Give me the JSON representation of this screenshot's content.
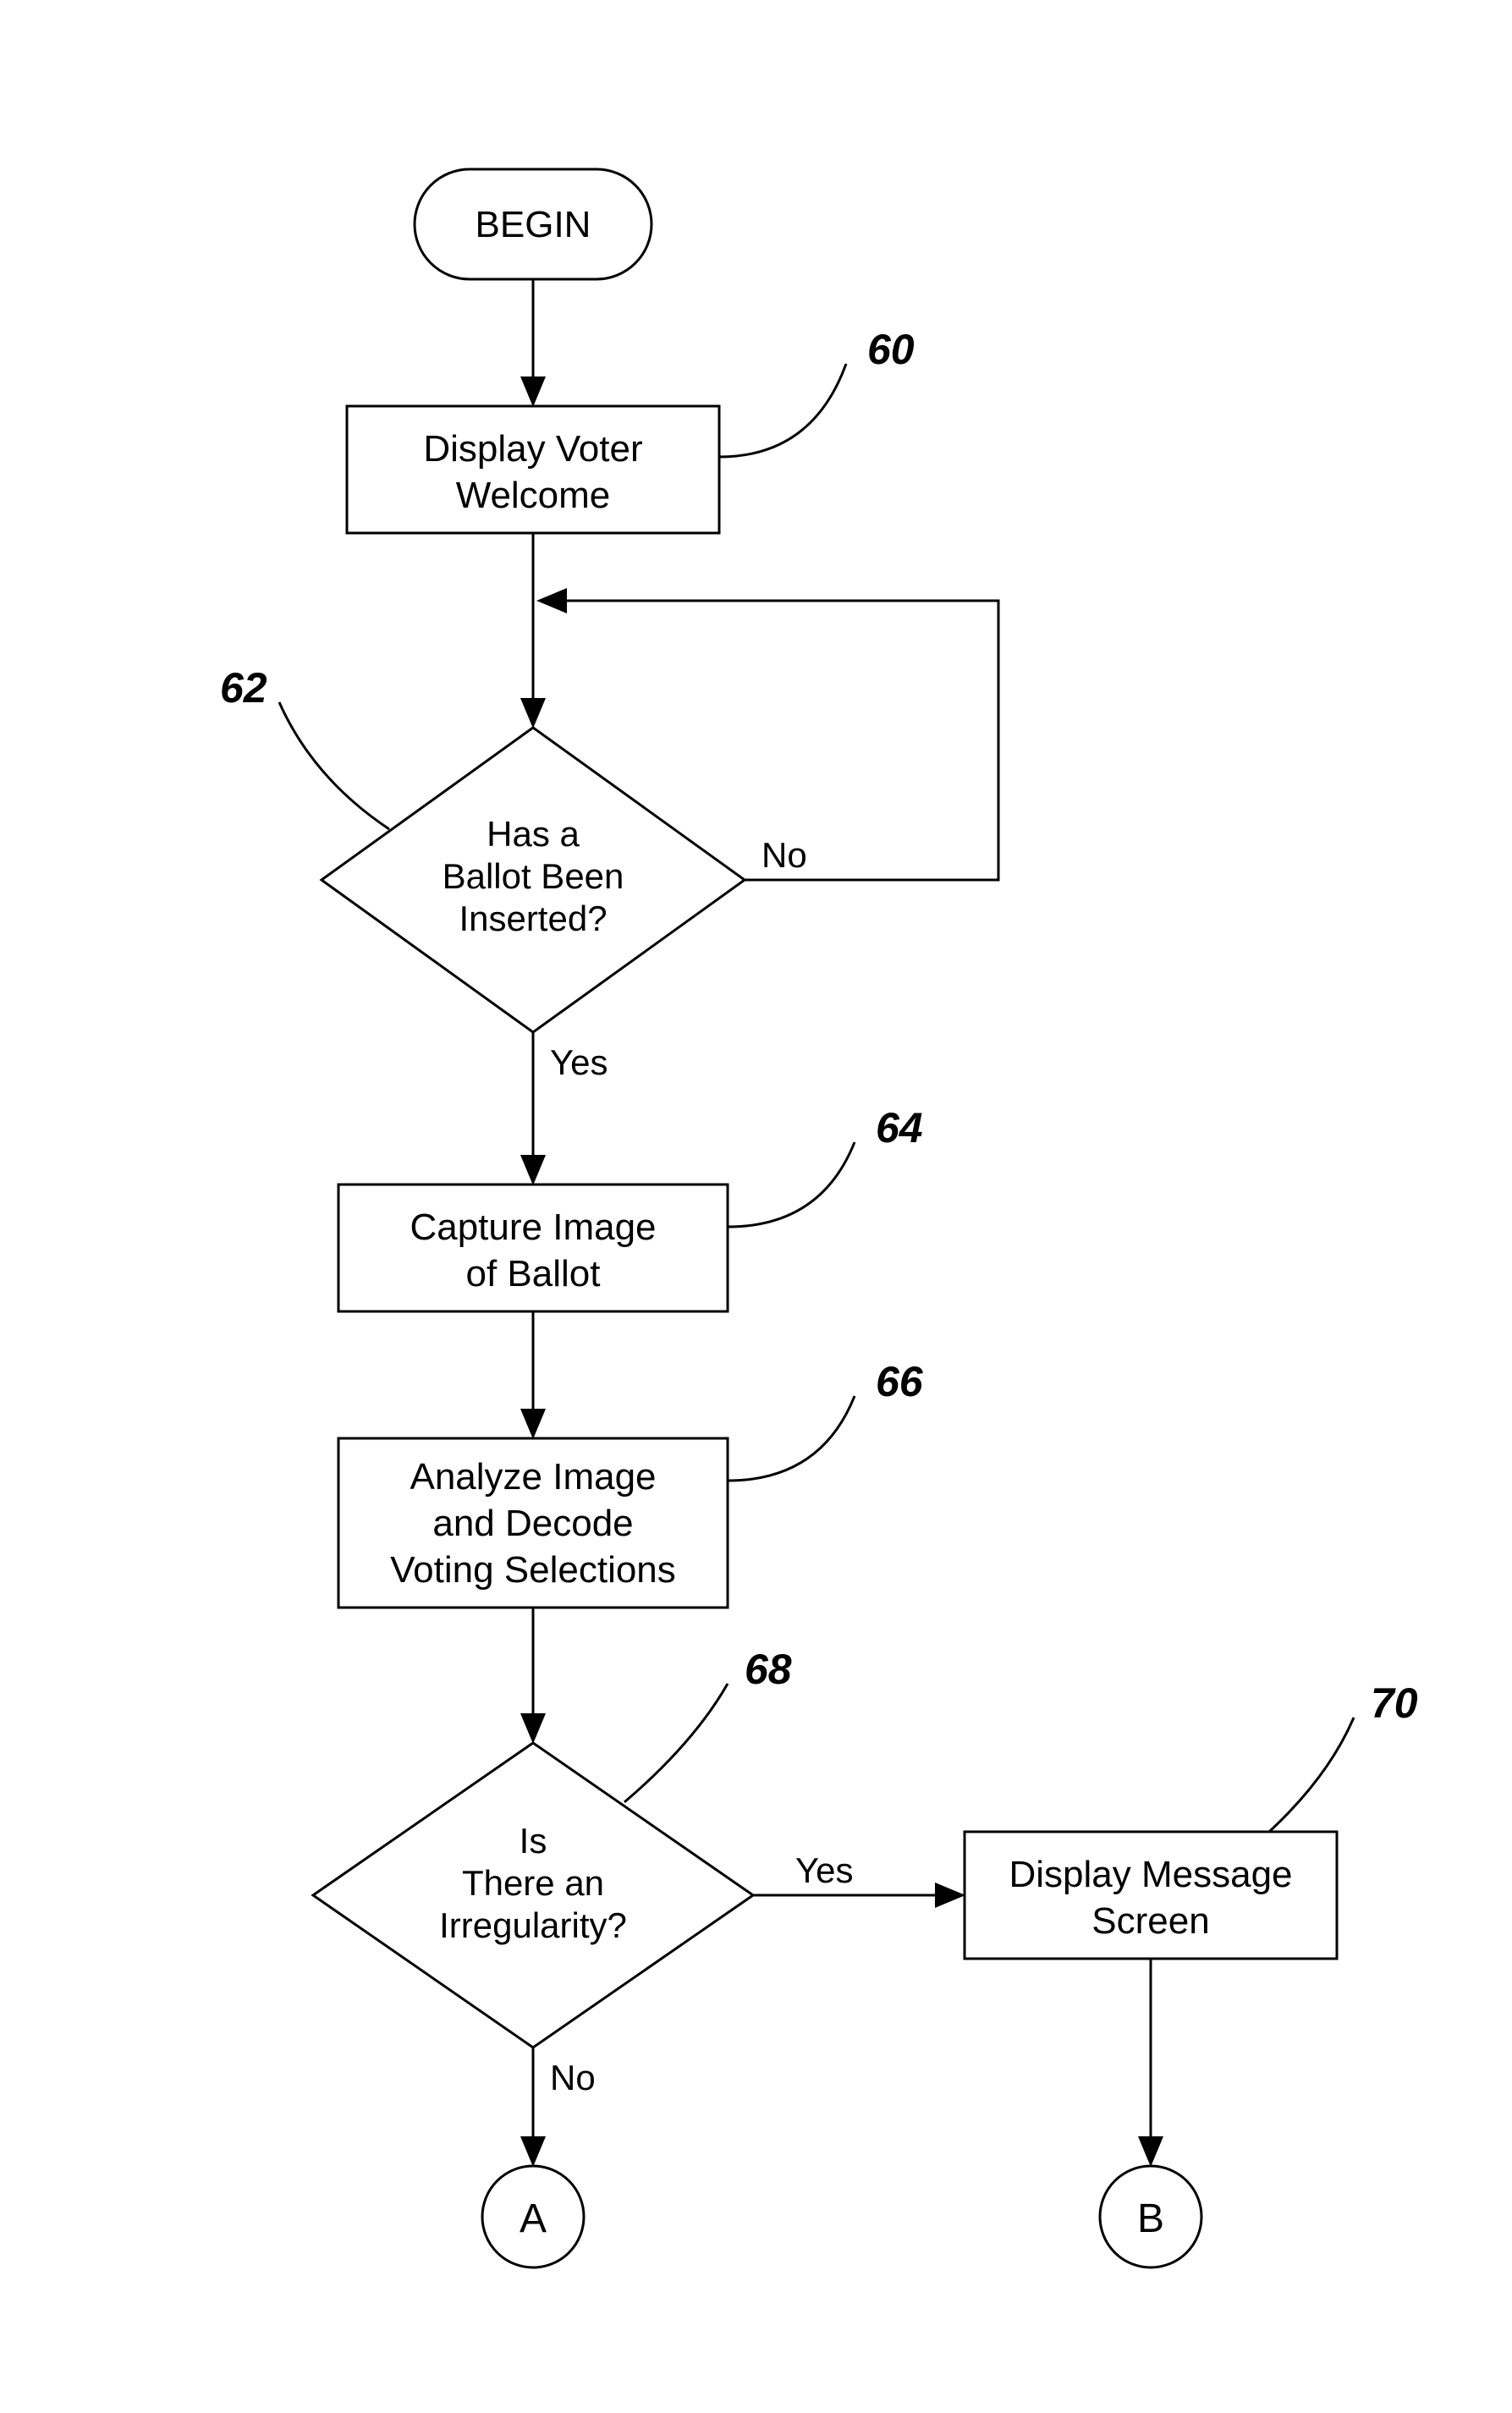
{
  "nodes": {
    "begin": {
      "label": "BEGIN"
    },
    "welcome": {
      "line1": "Display Voter",
      "line2": "Welcome",
      "ref": "60"
    },
    "ballot_inserted": {
      "line1": "Has a",
      "line2": "Ballot Been",
      "line3": "Inserted?",
      "ref": "62"
    },
    "capture": {
      "line1": "Capture Image",
      "line2": "of Ballot",
      "ref": "64"
    },
    "analyze": {
      "line1": "Analyze Image",
      "line2": "and Decode",
      "line3": "Voting Selections",
      "ref": "66"
    },
    "irregularity": {
      "line1": "Is",
      "line2": "There an",
      "line3": "Irregularity?",
      "ref": "68"
    },
    "display_msg": {
      "line1": "Display Message",
      "line2": "Screen",
      "ref": "70"
    },
    "connA": {
      "label": "A"
    },
    "connB": {
      "label": "B"
    }
  },
  "edges": {
    "yes": "Yes",
    "no": "No"
  }
}
